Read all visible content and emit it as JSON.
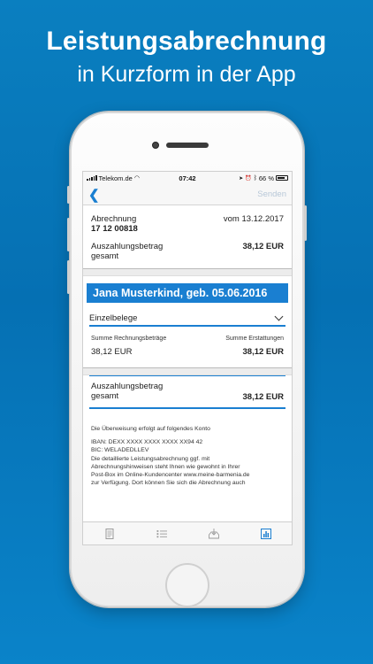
{
  "promo": {
    "title": "Leistungsabrechnung",
    "subtitle": "in Kurzform in der App"
  },
  "status_bar": {
    "carrier": "Telekom.de",
    "time": "07:42",
    "battery": "66 %"
  },
  "nav": {
    "back_glyph": "❮",
    "send_label": "Senden"
  },
  "summary": {
    "abrechnung_label": "Abrechnung",
    "abrechnung_number": "17 12 00818",
    "date": "vom 13.12.2017",
    "payout_label_line1": "Auszahlungsbetrag",
    "payout_label_line2": "gesamt",
    "payout_amount": "38,12 EUR"
  },
  "person": {
    "name": "Jana Musterkind, geb. 05.06.2016"
  },
  "receipts": {
    "dropdown_label": "Einzelbelege",
    "sum_invoices_label": "Summe Rechnungsbeträge",
    "sum_refunds_label": "Summe Erstattungen",
    "sum_invoices_value": "38,12 EUR",
    "sum_refunds_value": "38,12 EUR"
  },
  "total": {
    "label_line1": "Auszahlungsbetrag",
    "label_line2": "gesamt",
    "amount": "38,12 EUR"
  },
  "transfer": {
    "intro": "Die Überweisung erfolgt auf folgendes Konto",
    "iban": "IBAN: DEXX XXXX XXXX XXXX XX94 42",
    "bic": "BIC: WELADEDLLEV",
    "note_line1": "Die detaillierte Leistungsabrechnung ggf. mit",
    "note_line2": "Abrechnungshinweisen steht Ihnen wie gewohnt in Ihrer",
    "note_line3": "Post-Box im Online-Kundencenter www.meine-barmenia.de",
    "note_line4": "zur Verfügung. Dort können Sie sich die Abrechnung auch"
  },
  "tabs": [
    {
      "icon": "document-icon"
    },
    {
      "icon": "list-icon"
    },
    {
      "icon": "inbox-download-icon"
    },
    {
      "icon": "chart-icon"
    }
  ],
  "colors": {
    "accent": "#1a7fd1",
    "background_top": "#0a7fc0",
    "background_bottom": "#0a83c9"
  }
}
